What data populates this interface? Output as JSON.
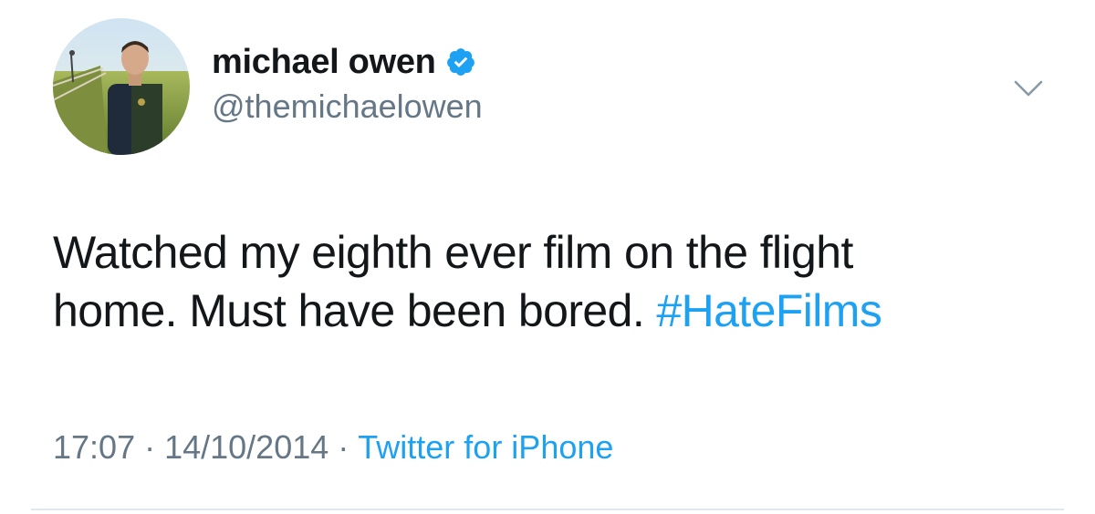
{
  "user": {
    "display_name": "michael owen",
    "handle": "@themichaelowen",
    "verified": true
  },
  "tweet": {
    "line1": "Watched my eighth ever film on the flight",
    "line2_text": "home. Must have been bored.",
    "hashtag": "#HateFilms"
  },
  "meta": {
    "time": "17:07",
    "separator": "·",
    "date": "14/10/2014",
    "source": "Twitter for iPhone"
  },
  "icons": {
    "verified": "verified-badge-icon",
    "menu": "chevron-down-icon"
  },
  "colors": {
    "text": "#14171a",
    "secondary": "#657786",
    "link": "#1da1f2",
    "divider": "#e1e8ed"
  }
}
